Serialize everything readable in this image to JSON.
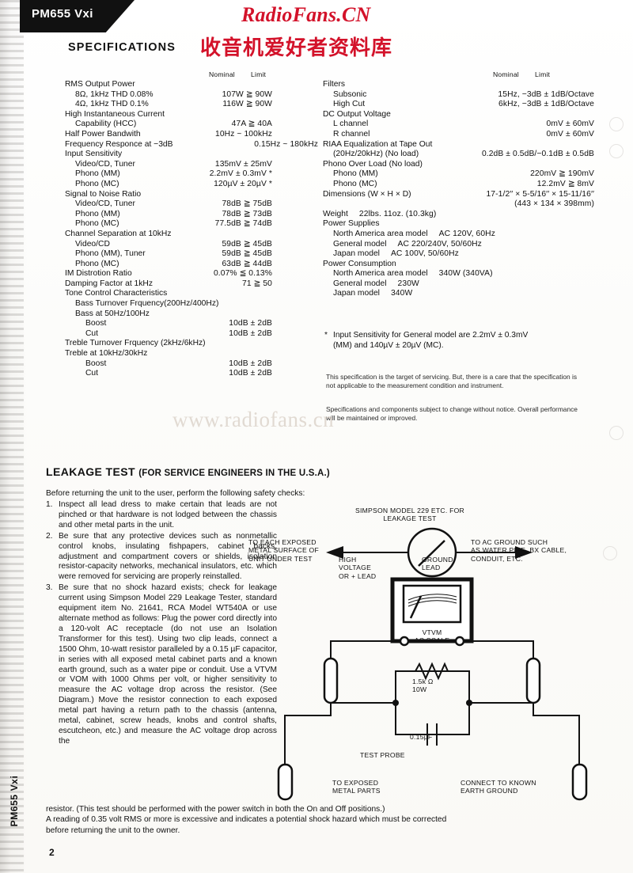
{
  "model_tab": {
    "label": "PM655 Vxi"
  },
  "watermarks": {
    "radiofans": "RadioFans.CN",
    "chinese": "收音机爱好者资料库",
    "url": "www.radiofans.cn"
  },
  "page": {
    "number": "2",
    "side_label": "PM655 Vxi"
  },
  "specifications": {
    "title": "SPECIFICATIONS",
    "column_headers": {
      "nominal": "Nominal",
      "limit": "Limit"
    },
    "left_rows": [
      {
        "indent": 0,
        "name": "RMS Output Power",
        "value": ""
      },
      {
        "indent": 1,
        "name": "8Ω, 1kHz THD 0.08%",
        "value": "107W ≧ 90W"
      },
      {
        "indent": 1,
        "name": "4Ω, 1kHz THD 0.1%",
        "value": "116W ≧ 90W"
      },
      {
        "indent": 0,
        "name": "High Instantaneous Current",
        "value": ""
      },
      {
        "indent": 1,
        "name": "Capability (HCC)",
        "value": "47A ≧ 40A"
      },
      {
        "indent": 0,
        "name": "Half Power Bandwith",
        "value": "10Hz ~ 100kHz"
      },
      {
        "indent": 0,
        "name": "Frequency Responce at −3dB",
        "value": "0.15Hz ~ 180kHz",
        "wide": true
      },
      {
        "indent": 0,
        "name": "Input Sensitivity",
        "value": ""
      },
      {
        "indent": 1,
        "name": "Video/CD, Tuner",
        "value": "135mV ± 25mV"
      },
      {
        "indent": 1,
        "name": "Phono (MM)",
        "value": "2.2mV ± 0.3mV *"
      },
      {
        "indent": 1,
        "name": "Phono (MC)",
        "value": "120µV ± 20µV *"
      },
      {
        "indent": 0,
        "name": "Signal to Noise Ratio",
        "value": ""
      },
      {
        "indent": 1,
        "name": "Video/CD, Tuner",
        "value": "78dB ≧ 75dB"
      },
      {
        "indent": 1,
        "name": "Phono (MM)",
        "value": "78dB ≧ 73dB"
      },
      {
        "indent": 1,
        "name": "Phono (MC)",
        "value": "77.5dB ≧ 74dB"
      },
      {
        "indent": 0,
        "name": "Channel Separation at 10kHz",
        "value": ""
      },
      {
        "indent": 1,
        "name": "Video/CD",
        "value": "59dB ≧ 45dB"
      },
      {
        "indent": 1,
        "name": "Phono (MM), Tuner",
        "value": "59dB ≧ 45dB"
      },
      {
        "indent": 1,
        "name": "Phono (MC)",
        "value": "63dB ≧ 44dB"
      },
      {
        "indent": 0,
        "name": "IM Distrotion Ratio",
        "value": "0.07% ≦ 0.13%"
      },
      {
        "indent": 0,
        "name": "Damping Factor at 1kHz",
        "value": "71 ≧ 50"
      },
      {
        "indent": 0,
        "name": "Tone Control Characteristics",
        "value": ""
      },
      {
        "indent": 1,
        "name": "Bass Turnover Frquency(200Hz/400Hz)",
        "value": ""
      },
      {
        "indent": 1,
        "name": "Bass at 50Hz/100Hz",
        "value": ""
      },
      {
        "indent": 2,
        "name": "Boost",
        "value": "10dB ± 2dB"
      },
      {
        "indent": 2,
        "name": "Cut",
        "value": "10dB ± 2dB"
      },
      {
        "indent": 0,
        "name": "Treble Turnover Frquency (2kHz/6kHz)",
        "value": ""
      },
      {
        "indent": 0,
        "name": "Treble at 10kHz/30kHz",
        "value": ""
      },
      {
        "indent": 2,
        "name": "Boost",
        "value": "10dB ± 2dB"
      },
      {
        "indent": 2,
        "name": "Cut",
        "value": "10dB ± 2dB"
      }
    ],
    "right_rows": [
      {
        "indent": 0,
        "name": "Filters",
        "value": ""
      },
      {
        "indent": 1,
        "name": "Subsonic",
        "value": "15Hz, −3dB ± 1dB/Octave"
      },
      {
        "indent": 1,
        "name": "High Cut",
        "value": "6kHz, −3dB ± 1dB/Octave"
      },
      {
        "indent": 0,
        "name": "DC Output Voltage",
        "value": ""
      },
      {
        "indent": 1,
        "name": "L channel",
        "value": "0mV ± 60mV"
      },
      {
        "indent": 1,
        "name": "R channel",
        "value": "0mV ± 60mV"
      },
      {
        "indent": 0,
        "name": "RIAA Equalization at Tape Out",
        "value": ""
      },
      {
        "indent": 1,
        "name": "(20Hz/20kHz) (No load)",
        "value": "0.2dB ± 0.5dB/−0.1dB ± 0.5dB"
      },
      {
        "indent": 0,
        "name": "Phono Over Load (No load)",
        "value": ""
      },
      {
        "indent": 1,
        "name": "Phono (MM)",
        "value": "220mV ≧ 190mV"
      },
      {
        "indent": 1,
        "name": "Phono (MC)",
        "value": "12.2mV ≧ 8mV"
      },
      {
        "indent": 0,
        "name": "Dimensions (W × H × D)",
        "value": "17-1/2′′ × 5-5/16′′ × 15-11/16′′"
      },
      {
        "indent": 0,
        "name": "",
        "value": "(443 × 134 × 398mm)"
      },
      {
        "indent": 0,
        "name": "Weight",
        "value": "22lbs. 11oz. (10.3kg)",
        "left_value": true
      },
      {
        "indent": 0,
        "name": "Power Supplies",
        "value": ""
      },
      {
        "indent": 1,
        "name": "North America area model",
        "value": "AC 120V, 60Hz",
        "left_value": true
      },
      {
        "indent": 1,
        "name": "General model",
        "value": "AC 220/240V, 50/60Hz",
        "left_value": true
      },
      {
        "indent": 1,
        "name": "Japan model",
        "value": "AC 100V, 50/60Hz",
        "left_value": true
      },
      {
        "indent": 0,
        "name": "Power Consumption",
        "value": ""
      },
      {
        "indent": 1,
        "name": "North America area model",
        "value": "340W (340VA)",
        "left_value": true
      },
      {
        "indent": 1,
        "name": "General model",
        "value": "230W",
        "left_value": true
      },
      {
        "indent": 1,
        "name": "Japan model",
        "value": "340W",
        "left_value": true
      }
    ],
    "footnote": {
      "marker": "*",
      "line1": "Input Sensitivity for General model are 2.2mV ± 0.3mV",
      "line2": "(MM) and 140µV ± 20µV (MC)."
    },
    "fineprint_1": "This specification is the target of servicing. But, there is a care that the specification is not applicable to the measurement condition and instrument.",
    "fineprint_2": "Specifications and components subject to change without notice. Overall performance will be maintained or improved."
  },
  "leakage_test": {
    "title": "LEAKAGE TEST",
    "title_sub": "(FOR SERVICE ENGINEERS IN THE U.S.A.)",
    "intro": "Before returning the unit to the user, perform the following safety checks:",
    "items": [
      {
        "num": "1.",
        "text": "Inspect all lead dress to make certain that leads are not pinched or that hardware is not lodged between the chassis and other metal parts in the unit."
      },
      {
        "num": "2.",
        "text": "Be sure that any protective devices such as nonmetallic control knobs, insulating fishpapers, cabinet backs, adjustment and compartment covers or shields, isolation resistor-capacity networks, mechanical insulators, etc. which were removed for servicing are properly reinstalled."
      },
      {
        "num": "3.",
        "text": "Be sure that no shock hazard exists; check for leakage current using Simpson Model 229 Leakage Tester, standard equipment item No. 21641, RCA Model WT540A or use alternate method as follows: Plug the power cord directly into a 120-volt AC receptacle (do not use an Isolation Transformer for this test). Using two clip leads, connect a 1500 Ohm, 10-watt resistor paralleled by a 0.15 µF capacitor, in series with all exposed metal cabinet parts and a known earth ground, such as a water pipe or conduit. Use a VTVM or VOM with 1000 Ohms per volt, or higher sensitivity to measure the AC voltage drop across the resistor. (See Diagram.) Move the resistor connection to each exposed metal part having a return path to the chassis (antenna, metal, cabinet, screw heads, knobs and control shafts, escutcheon, etc.) and measure the AC voltage drop across the"
      }
    ],
    "tail_lines": [
      "resistor. (This test should be performed with the power switch in both the On and Off positions.)",
      "A reading of 0.35 volt RMS or more is excessive and indicates a potential shock hazard which must be corrected",
      "before returning the unit to the owner."
    ],
    "diagram": {
      "title": "SIMPSON MODEL 229 ETC. FOR\nLEAKAGE TEST",
      "left_label": "TO EACH EXPOSED\nMETAL SURFACE OF\nUNIT UNDER TEST",
      "high_voltage_label": "HIGH\nVOLTAGE\nOR + LEAD",
      "ground_lead_label": "GROUND\nLEAD",
      "right_label": "TO AC GROUND SUCH\nAS WATER PIPE, BX CABLE,\nCONDUIT, ETC.",
      "meter_label": "VTVM\nAC SCALE",
      "resistor_label": "1.5k Ω\n10W",
      "capacitor_label": "0.15µF",
      "test_probe_label": "TEST PROBE",
      "exposed_metal_label": "TO EXPOSED\nMETAL PARTS",
      "earth_ground_label": "CONNECT TO KNOWN\nEARTH GROUND"
    }
  }
}
